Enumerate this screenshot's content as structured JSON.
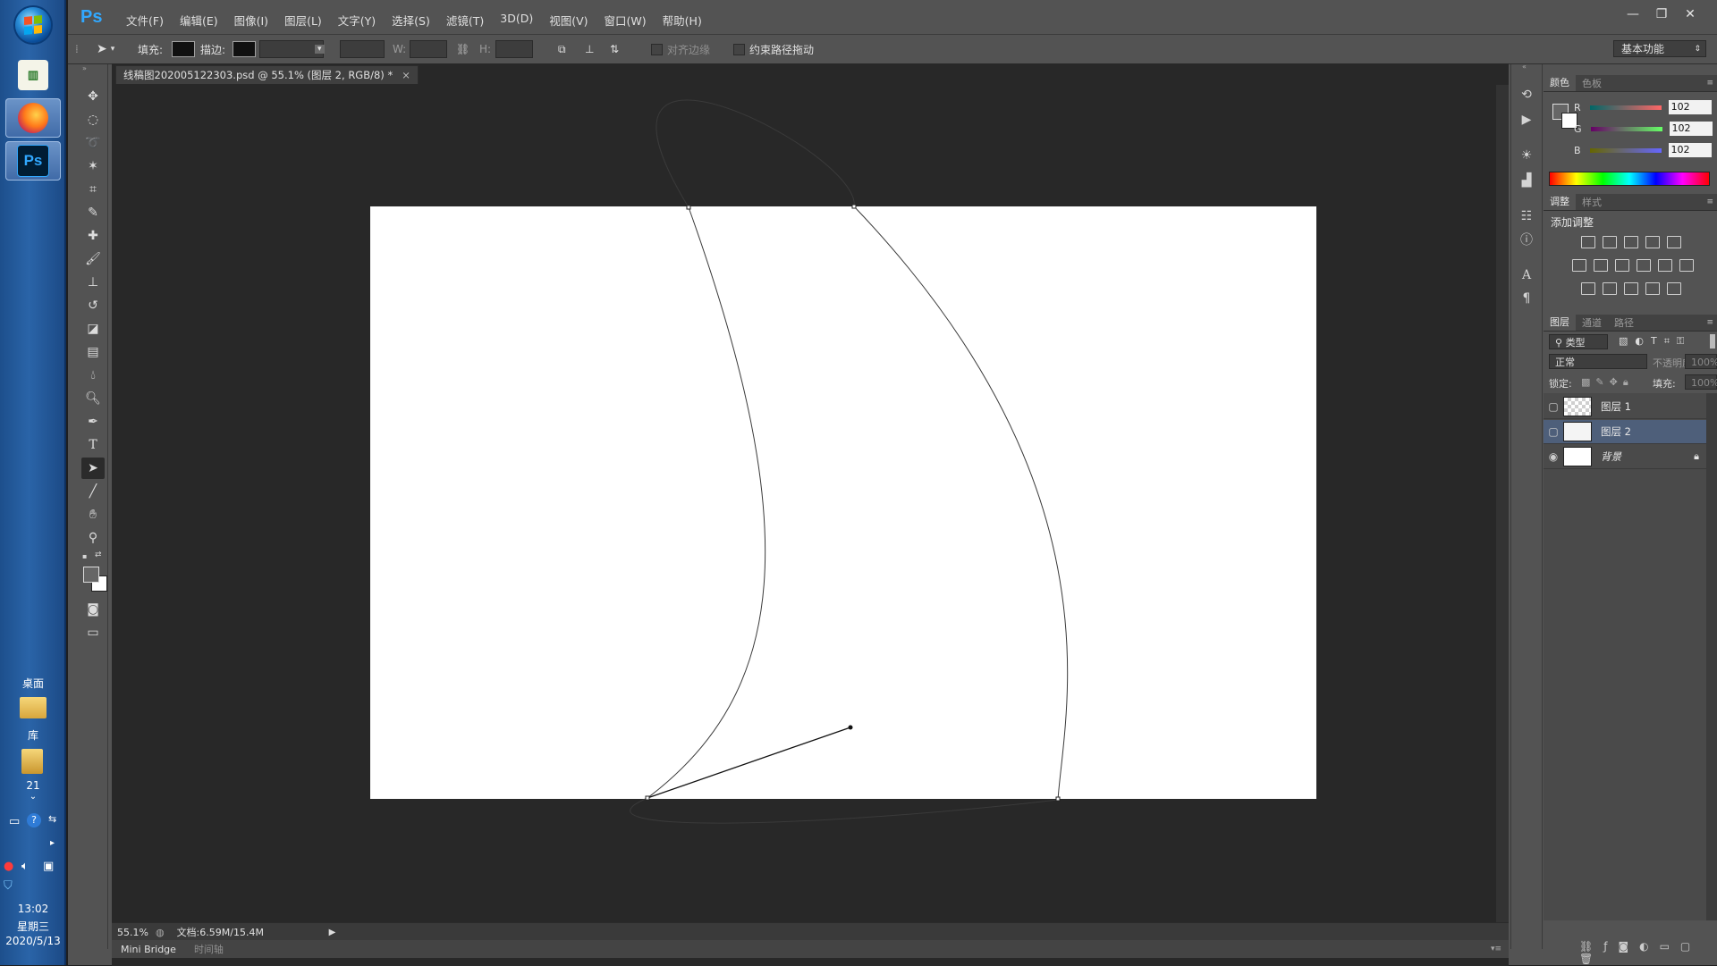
{
  "taskbar": {
    "desktop_label": "桌面",
    "library_label": "库",
    "folder_count": "21",
    "clock_time": "13:02",
    "clock_weekday": "星期三",
    "clock_date": "2020/5/13"
  },
  "app": {
    "logo": "Ps",
    "menus": [
      "文件(F)",
      "编辑(E)",
      "图像(I)",
      "图层(L)",
      "文字(Y)",
      "选择(S)",
      "滤镜(T)",
      "3D(D)",
      "视图(V)",
      "窗口(W)",
      "帮助(H)"
    ]
  },
  "options": {
    "fill_label": "填充:",
    "stroke_label": "描边:",
    "w_label": "W:",
    "h_label": "H:",
    "align_edges_label": "对齐边缘",
    "constrain_label": "约束路径拖动",
    "workspace": "基本功能"
  },
  "document": {
    "tab_title": "线稿图202005122303.psd @ 55.1% (图层 2, RGB/8) *",
    "zoom": "55.1%",
    "doc_size": "文档:6.59M/15.4M",
    "bottom_tabs": [
      "Mini Bridge",
      "时间轴"
    ]
  },
  "color_panel": {
    "tabs": [
      "颜色",
      "色板"
    ],
    "r_label": "R",
    "g_label": "G",
    "b_label": "B",
    "r": "102",
    "g": "102",
    "b": "102"
  },
  "adjust_panel": {
    "tabs": [
      "调整",
      "样式"
    ],
    "heading": "添加调整"
  },
  "layers_panel": {
    "tabs": [
      "图层",
      "通道",
      "路径"
    ],
    "filter_kind": "类型",
    "blend_mode": "正常",
    "opacity_label": "不透明度:",
    "opacity": "100%",
    "lock_label": "锁定:",
    "fill_label": "填充:",
    "fill": "100%",
    "layers": [
      {
        "name": "图层 1",
        "visible": false,
        "selected": false
      },
      {
        "name": "图层 2",
        "visible": false,
        "selected": true
      },
      {
        "name": "背景",
        "visible": true,
        "selected": false
      }
    ]
  },
  "colors": {
    "canvas_bg": "#282828",
    "ui_panel": "#535353",
    "selection": "#4e5f7a",
    "ps_blue": "#31a8ff"
  }
}
